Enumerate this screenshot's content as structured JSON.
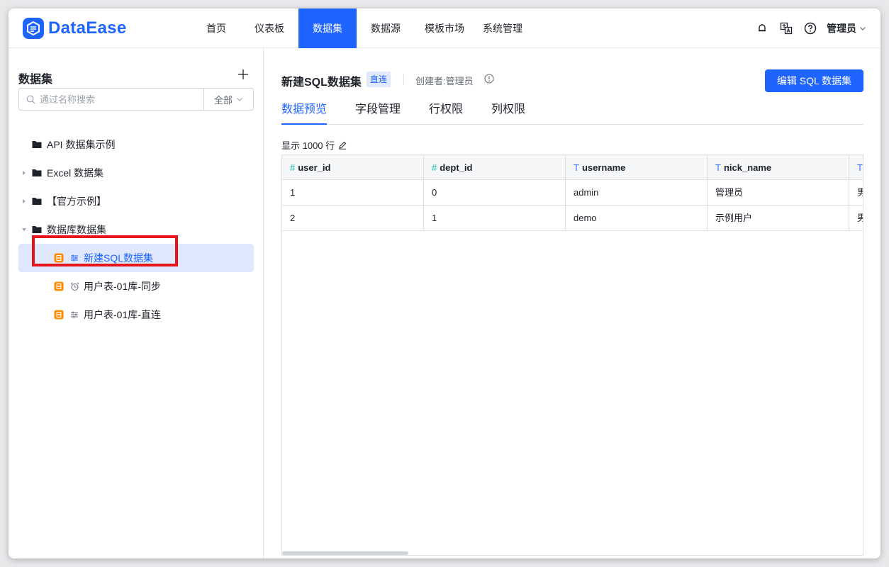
{
  "app": {
    "logo_text": "DataEase",
    "brand_color": "#1F64FF"
  },
  "nav": {
    "items": [
      {
        "label": "首页"
      },
      {
        "label": "仪表板"
      },
      {
        "label": "数据集",
        "active": true
      },
      {
        "label": "数据源"
      },
      {
        "label": "模板市场"
      },
      {
        "label": "系统管理"
      }
    ],
    "user_name": "管理员",
    "icons": [
      "notification-icon",
      "translate-icon",
      "help-icon",
      "chevron-down-icon"
    ]
  },
  "sidebar": {
    "title": "数据集",
    "search_placeholder": "通过名称搜索",
    "filter_label": "全部",
    "tree": [
      {
        "label": "API 数据集示例",
        "type": "folder"
      },
      {
        "label": "Excel 数据集",
        "type": "folder",
        "collapsed": true
      },
      {
        "label": "【官方示例】",
        "type": "folder",
        "collapsed": true
      },
      {
        "label": "数据库数据集",
        "type": "folder",
        "expanded": true
      },
      {
        "label": "新建SQL数据集",
        "type": "dataset",
        "mode": "direct",
        "selected": true
      },
      {
        "label": "用户表-01库-同步",
        "type": "dataset",
        "mode": "sync"
      },
      {
        "label": "用户表-01库-直连",
        "type": "dataset",
        "mode": "direct"
      }
    ]
  },
  "main": {
    "title": "新建SQL数据集",
    "tag": "直连",
    "creator": "创建者:管理员",
    "edit_button": "编辑 SQL 数据集",
    "tabs": [
      {
        "label": "数据预览",
        "active": true
      },
      {
        "label": "字段管理"
      },
      {
        "label": "行权限"
      },
      {
        "label": "列权限"
      }
    ],
    "row_count_label": "显示 1000 行",
    "grid": {
      "columns": [
        {
          "type_icon": "#",
          "name": "user_id"
        },
        {
          "type_icon": "T",
          "name": "dept_id",
          "type_icon_override": "#"
        },
        {
          "type_icon": "T",
          "name": "username"
        },
        {
          "type_icon": "T",
          "name": "nick_name"
        },
        {
          "type_icon": "T",
          "name": ""
        }
      ],
      "rows": [
        [
          "1",
          "0",
          "admin",
          "管理员",
          "男"
        ],
        [
          "2",
          "1",
          "demo",
          "示例用户",
          "男"
        ]
      ]
    }
  }
}
